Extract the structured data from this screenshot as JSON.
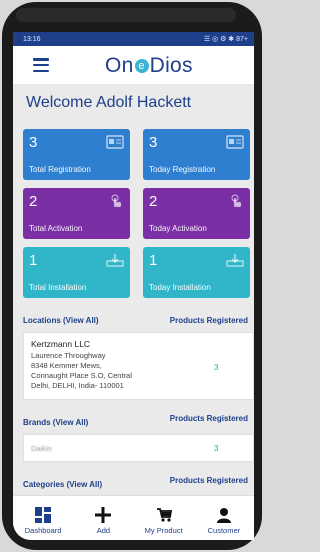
{
  "status_bar": {
    "time": "13:16",
    "right_icons": "☰ ◎ ⚙ ✱ 87+"
  },
  "header": {
    "logo_before": "On",
    "logo_mid": "e",
    "logo_after": "Dios"
  },
  "welcome": "Welcome Adolf Hackett",
  "cards": [
    {
      "value": "3",
      "label": "Total Registration",
      "icon": "id-card-icon",
      "color": "#2f7fd0"
    },
    {
      "value": "3",
      "label": "Today Registration",
      "icon": "id-card-icon",
      "color": "#2f7fd0"
    },
    {
      "value": "2",
      "label": "Total Activation",
      "icon": "tap-icon",
      "color": "#7b2fa5"
    },
    {
      "value": "2",
      "label": "Today Activation",
      "icon": "tap-icon",
      "color": "#7b2fa5"
    },
    {
      "value": "1",
      "label": "Total Installation",
      "icon": "download-icon",
      "color": "#31b6c9"
    },
    {
      "value": "1",
      "label": "Today Installation",
      "icon": "download-icon",
      "color": "#31b6c9"
    }
  ],
  "locations": {
    "title": "Locations (View All)",
    "right": "Products Registered",
    "name": "Kertzmann LLC",
    "line1": "Laurence Throughway",
    "line2": "8348 Kemmer Mews,",
    "line3": "Connaught Place S.O, Central",
    "line4": "Delhi, DELHI, India- 110001",
    "count": "3"
  },
  "brands": {
    "title": "Brands (View All)",
    "right": "Products Registered",
    "name": "Daikin",
    "count": "3"
  },
  "categories": {
    "title": "Categories (View All)",
    "right": "Products Registered"
  },
  "tabs": [
    {
      "label": "Dashboard",
      "icon": "dashboard-icon"
    },
    {
      "label": "Add",
      "icon": "plus-icon"
    },
    {
      "label": "My Product",
      "icon": "cart-icon"
    },
    {
      "label": "Customer",
      "icon": "user-icon"
    }
  ]
}
